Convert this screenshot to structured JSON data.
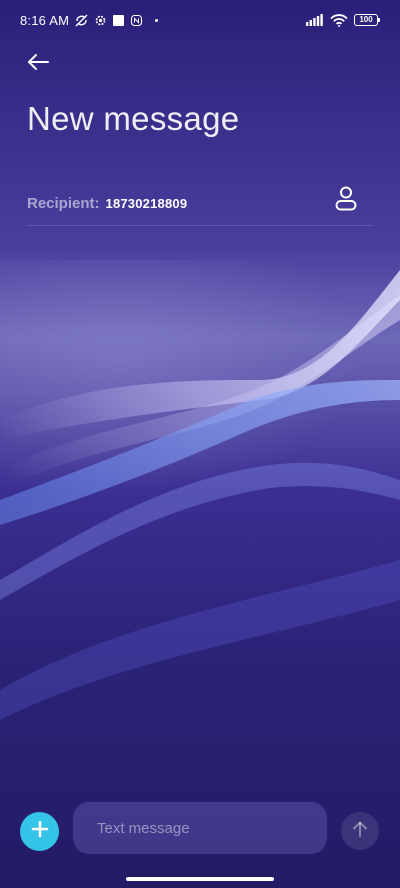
{
  "status_bar": {
    "time": "8:16 AM",
    "battery": "100",
    "icons": [
      "no-sync-icon",
      "settings-gear-icon",
      "square-icon",
      "nfc-icon",
      "dot-icon",
      "signal-icon",
      "wifi-icon",
      "battery-icon"
    ]
  },
  "header": {
    "back_icon": "back-arrow-icon",
    "title": "New message"
  },
  "recipient": {
    "label": "Recipient:",
    "value": "18730218809",
    "contact_icon": "person-icon"
  },
  "composer": {
    "add_icon": "plus-icon",
    "placeholder": "Text message",
    "send_icon": "arrow-up-icon"
  },
  "colors": {
    "accent": "#33c4e8",
    "background_top": "#2a1f78",
    "background_mid": "#6e68b8",
    "background_bottom": "#241b66"
  }
}
